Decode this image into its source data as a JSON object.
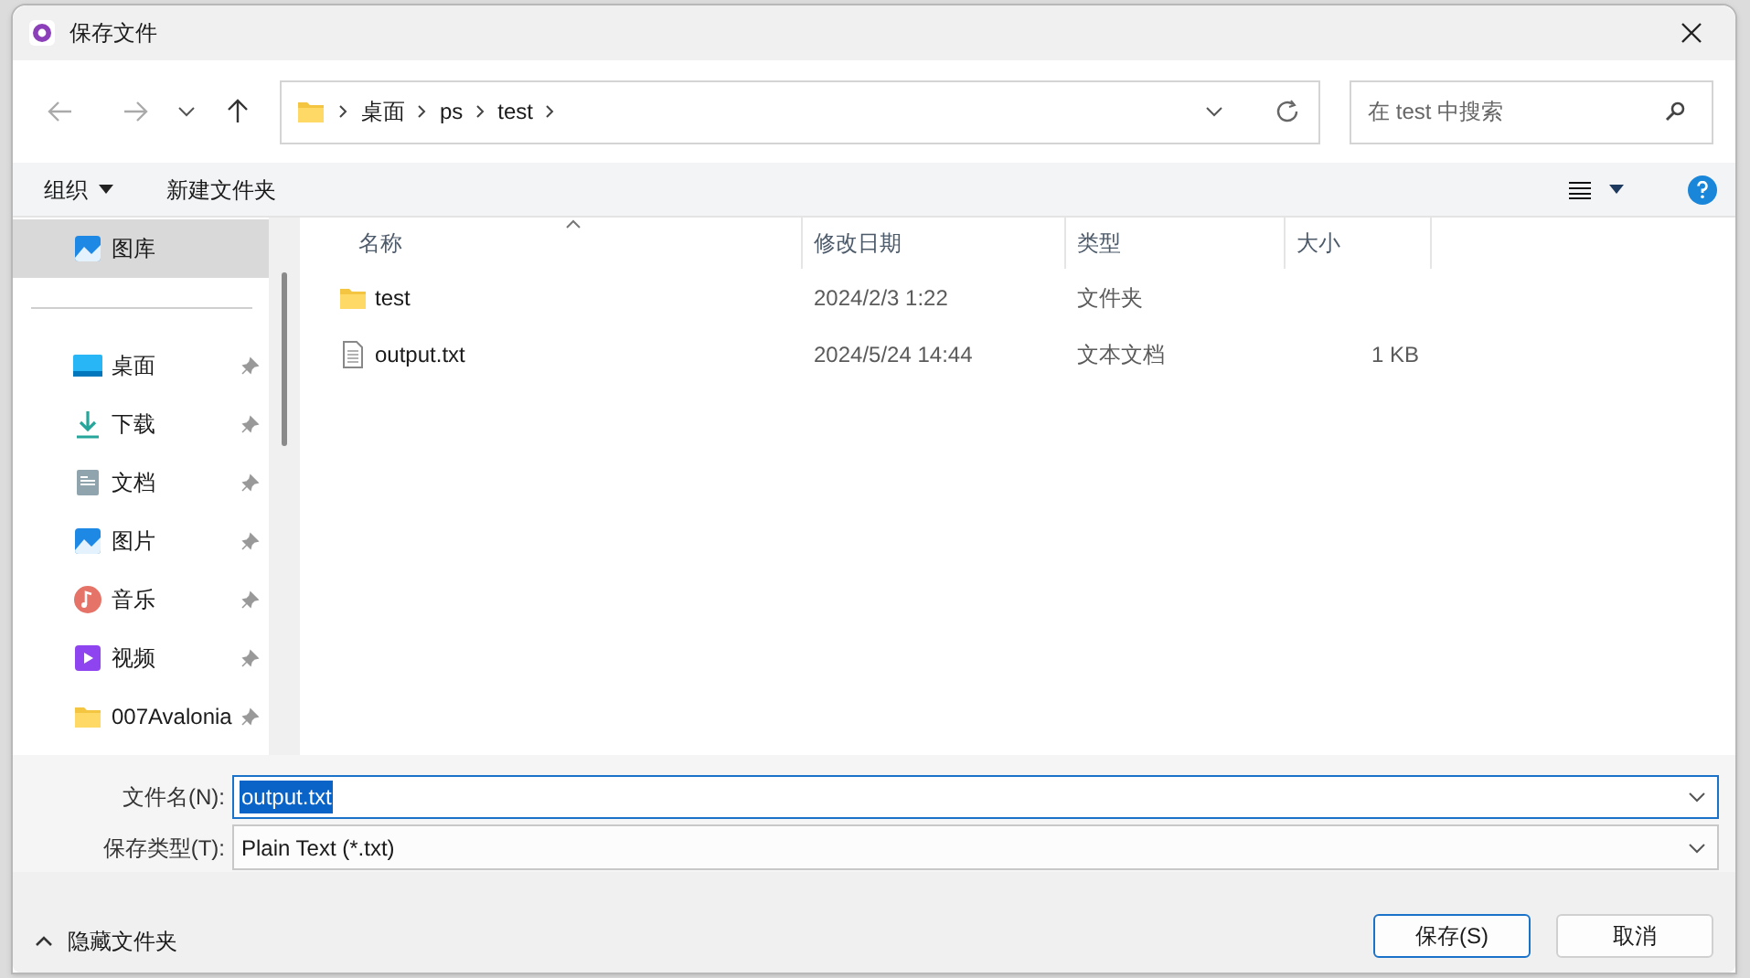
{
  "window": {
    "title": "保存文件"
  },
  "address_bar": {
    "crumbs": [
      "桌面",
      "ps",
      "test"
    ]
  },
  "search": {
    "placeholder": "在 test 中搜索"
  },
  "toolbar": {
    "organize": "组织",
    "new_folder": "新建文件夹"
  },
  "sidebar": {
    "items": [
      {
        "label": "图库",
        "kind": "gallery",
        "selected": true,
        "pinned": false
      },
      {
        "label": "桌面",
        "kind": "desktop",
        "selected": false,
        "pinned": true
      },
      {
        "label": "下载",
        "kind": "download",
        "selected": false,
        "pinned": true
      },
      {
        "label": "文档",
        "kind": "documents",
        "selected": false,
        "pinned": true
      },
      {
        "label": "图片",
        "kind": "pictures",
        "selected": false,
        "pinned": true
      },
      {
        "label": "音乐",
        "kind": "music",
        "selected": false,
        "pinned": true
      },
      {
        "label": "视频",
        "kind": "video",
        "selected": false,
        "pinned": true
      },
      {
        "label": "007Avalonia",
        "kind": "folder",
        "selected": false,
        "pinned": true
      }
    ]
  },
  "table": {
    "columns": [
      "名称",
      "修改日期",
      "类型",
      "大小"
    ],
    "rows": [
      {
        "kind": "folder",
        "name": "test",
        "modified": "2024/2/3 1:22",
        "type": "文件夹",
        "size": ""
      },
      {
        "kind": "text",
        "name": "output.txt",
        "modified": "2024/5/24 14:44",
        "type": "文本文档",
        "size": "1 KB"
      }
    ]
  },
  "file_name": {
    "label": "文件名(N):",
    "value": "output.txt"
  },
  "file_type": {
    "label": "保存类型(T):",
    "value": "Plain Text (*.txt)"
  },
  "hide_folders": "隐藏文件夹",
  "buttons": [
    {
      "label": "保存(S)",
      "default": true
    },
    {
      "label": "取消",
      "default": false
    }
  ]
}
